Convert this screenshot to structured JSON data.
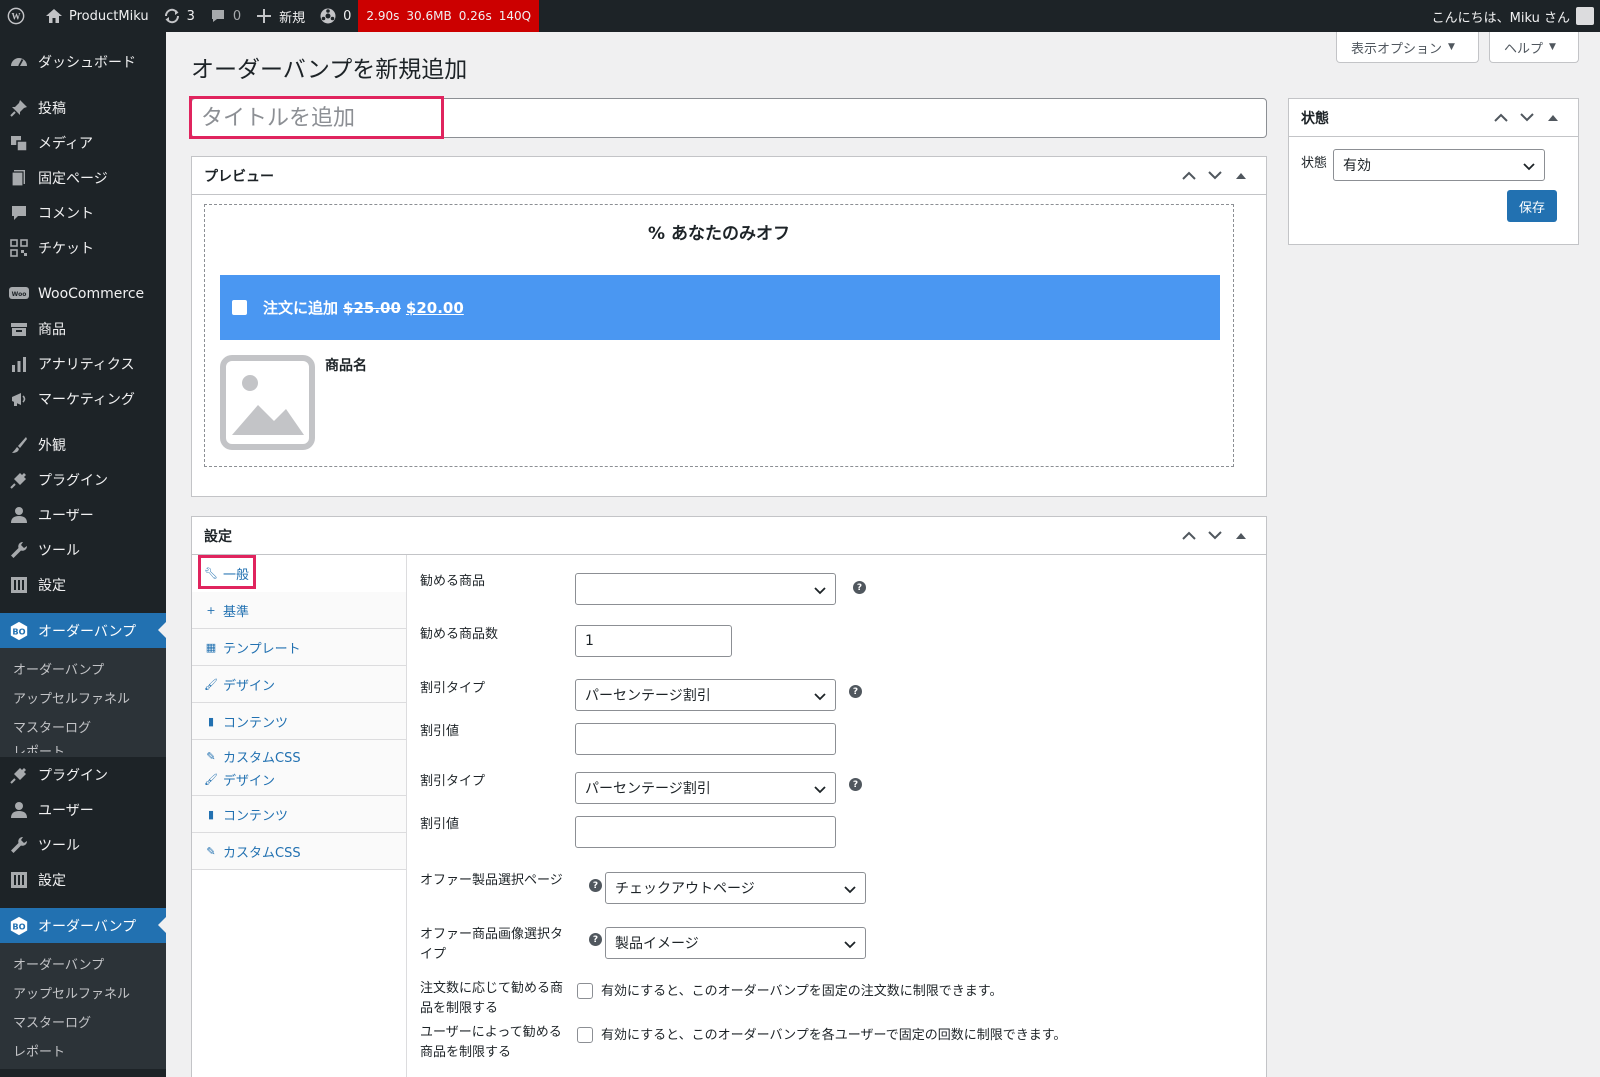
{
  "adminbar": {
    "site_name": "ProductMiku",
    "updates_count": "3",
    "comments_count": "0",
    "new_label": "新規",
    "cache_count": "0",
    "qm_time": "2.90s",
    "qm_memory": "30.6MB",
    "qm_db_time": "0.26s",
    "qm_queries": "140Q",
    "greeting": "こんにちは、Miku さん"
  },
  "sidebar": {
    "items": [
      {
        "label": "ダッシュボード",
        "icon": "dashboard-icon"
      },
      {
        "label": "投稿",
        "icon": "pin-icon"
      },
      {
        "label": "メディア",
        "icon": "media-icon"
      },
      {
        "label": "固定ページ",
        "icon": "page-icon"
      },
      {
        "label": "コメント",
        "icon": "comment-icon"
      },
      {
        "label": "チケット",
        "icon": "qr-icon"
      },
      {
        "label": "WooCommerce",
        "icon": "woo-icon"
      },
      {
        "label": "商品",
        "icon": "archive-icon"
      },
      {
        "label": "アナリティクス",
        "icon": "bar-chart-icon"
      },
      {
        "label": "マーケティング",
        "icon": "megaphone-icon"
      },
      {
        "label": "外観",
        "icon": "brush-icon"
      },
      {
        "label": "プラグイン",
        "icon": "plugin-icon"
      },
      {
        "label": "ユーザー",
        "icon": "user-icon"
      },
      {
        "label": "ツール",
        "icon": "wrench-icon"
      },
      {
        "label": "設定",
        "icon": "settings-icon"
      },
      {
        "label": "オーダーバンプ",
        "icon": "orderbump-icon"
      }
    ],
    "submenu": [
      "オーダーバンプ",
      "アップセルファネル",
      "マスターログ",
      "レポート"
    ],
    "repeat_items": [
      {
        "label": "プラグイン",
        "icon": "plugin-icon"
      },
      {
        "label": "ユーザー",
        "icon": "user-icon"
      },
      {
        "label": "ツール",
        "icon": "wrench-icon"
      },
      {
        "label": "設定",
        "icon": "settings-icon"
      },
      {
        "label": "オーダーバンプ",
        "icon": "orderbump-icon"
      }
    ],
    "repeat_submenu": [
      "オーダーバンプ",
      "アップセルファネル",
      "マスターログ",
      "レポート"
    ]
  },
  "screen_options": {
    "label": "表示オプション",
    "help_label": "ヘルプ"
  },
  "page": {
    "title": "オーダーバンプを新規追加",
    "title_placeholder": "タイトルを追加",
    "title_value": ""
  },
  "preview": {
    "heading": "プレビュー",
    "offer_heading": "% あなたのみオフ",
    "add_label": "注文に追加",
    "old_price": "$25.00",
    "new_price": "$20.00",
    "product_name": "商品名"
  },
  "status_box": {
    "heading": "状態",
    "label": "状態",
    "value": "有効",
    "save_label": "保存"
  },
  "settings": {
    "heading": "設定",
    "tabs": [
      {
        "label": "一般",
        "icon": "wrench-icon"
      },
      {
        "label": "基準",
        "icon": "plus-icon"
      },
      {
        "label": "テンプレート",
        "icon": "table-icon"
      },
      {
        "label": "デザイン",
        "icon": "brush-icon"
      },
      {
        "label": "コンテンツ",
        "icon": "book-icon"
      },
      {
        "label": "カスタムCSS",
        "icon": "pencil-icon"
      },
      {
        "label": "デザイン",
        "icon": "brush-icon"
      },
      {
        "label": "コンテンツ",
        "icon": "book-icon"
      },
      {
        "label": "カスタムCSS",
        "icon": "pencil-icon"
      }
    ],
    "fields": {
      "recommended_product": {
        "label": "勧める商品",
        "value": ""
      },
      "recommended_qty": {
        "label": "勧める商品数",
        "value": "1"
      },
      "discount_type_1": {
        "label": "割引タイプ",
        "value": "パーセンテージ割引"
      },
      "discount_value_1": {
        "label": "割引値",
        "value": ""
      },
      "discount_type_2": {
        "label": "割引タイプ",
        "value": "パーセンテージ割引"
      },
      "discount_value_2": {
        "label": "割引値",
        "value": ""
      },
      "offer_page": {
        "label": "オファー製品選択ページ",
        "value": "チェックアウトページ"
      },
      "offer_image": {
        "label_line1": "オファー商品画像選択タ",
        "label_line2": "イプ",
        "value": "製品イメージ"
      },
      "limit_by_order": {
        "label_line1": "注文数に応じて勧める商",
        "label_line2": "品を制限する",
        "text": "有効にすると、このオーダーバンプを固定の注文数に制限できます。"
      },
      "limit_by_user": {
        "label_line1": "ユーザーによって勧める",
        "label_line2": "商品を制限する",
        "text": "有効にすると、このオーダーバンプを各ユーザーで固定の回数に制限できます。"
      }
    }
  },
  "colors": {
    "sidebar_bg": "#1d2327",
    "accent": "#2271b1",
    "preview_bar": "#4a97f2",
    "highlight": "#e0245e",
    "qm_bar": "#cc0000"
  }
}
